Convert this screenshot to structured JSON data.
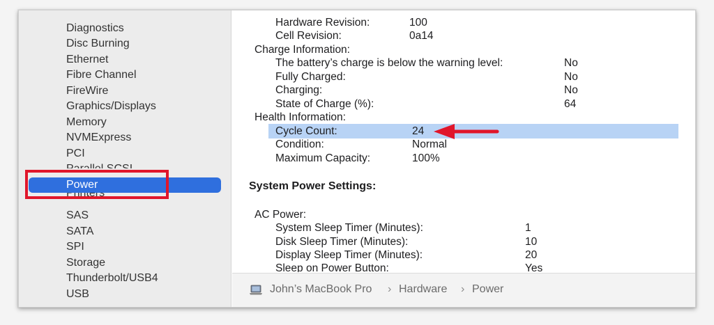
{
  "sidebar": {
    "items": [
      {
        "label": "Diagnostics"
      },
      {
        "label": "Disc Burning"
      },
      {
        "label": "Ethernet"
      },
      {
        "label": "Fibre Channel"
      },
      {
        "label": "FireWire"
      },
      {
        "label": "Graphics/Displays"
      },
      {
        "label": "Memory"
      },
      {
        "label": "NVMExpress"
      },
      {
        "label": "PCI"
      },
      {
        "label": "Parallel SCSI"
      },
      {
        "label": "Power"
      },
      {
        "label": "Printers"
      },
      {
        "label": "SAS"
      },
      {
        "label": "SATA"
      },
      {
        "label": "SPI"
      },
      {
        "label": "Storage"
      },
      {
        "label": "Thunderbolt/USB4"
      },
      {
        "label": "USB"
      }
    ],
    "selected": "Power",
    "selected_color": "#2f6fde",
    "highlight_box_color": "#e0162b"
  },
  "battery": {
    "hardware_revision": {
      "label": "Hardware Revision:",
      "value": "100"
    },
    "cell_revision": {
      "label": "Cell Revision:",
      "value": "0a14"
    },
    "charge_header": "Charge Information:",
    "below_warning": {
      "label": "The battery’s charge is below the warning level:",
      "value": "No"
    },
    "fully_charged": {
      "label": "Fully Charged:",
      "value": "No"
    },
    "charging": {
      "label": "Charging:",
      "value": "No"
    },
    "state_of_charge": {
      "label": "State of Charge (%):",
      "value": "64"
    },
    "health_header": "Health Information:",
    "cycle_count": {
      "label": "Cycle Count:",
      "value": "24"
    },
    "condition": {
      "label": "Condition:",
      "value": "Normal"
    },
    "max_capacity": {
      "label": "Maximum Capacity:",
      "value": "100%"
    }
  },
  "power_settings": {
    "title": "System Power Settings:",
    "ac_power_header": "AC Power:",
    "system_sleep": {
      "label": "System Sleep Timer (Minutes):",
      "value": "1"
    },
    "disk_sleep": {
      "label": "Disk Sleep Timer (Minutes):",
      "value": "10"
    },
    "display_sleep": {
      "label": "Display Sleep Timer (Minutes):",
      "value": "20"
    },
    "sleep_on_power_button": {
      "label": "Sleep on Power Button:",
      "value": "Yes"
    }
  },
  "highlight_row_color": "#b8d3f5",
  "annotation_arrow_color": "#e0162b",
  "pathbar": {
    "icon": "laptop-icon",
    "crumbs": [
      "John’s MacBook Pro",
      "Hardware",
      "Power"
    ],
    "separator": "›"
  }
}
